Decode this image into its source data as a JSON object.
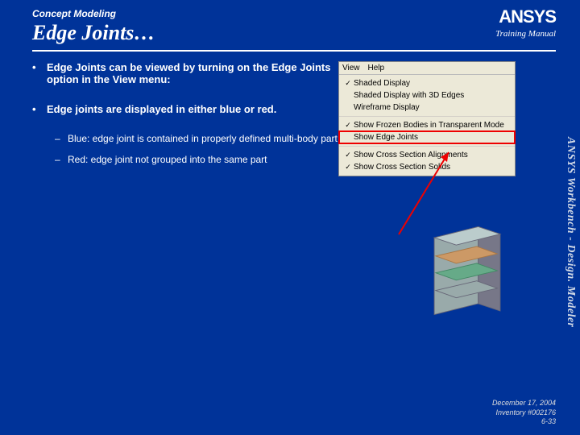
{
  "header": {
    "supertitle": "Concept Modeling",
    "title": "Edge Joints…",
    "logo": "ANSYS",
    "training": "Training Manual"
  },
  "bullets": {
    "b1": "Edge Joints can be viewed by turning on the Edge Joints option in the View menu:",
    "b2": "Edge joints are displayed in either blue or red.",
    "s1": "Blue: edge joint is contained in properly defined multi-body part",
    "s2": "Red: edge joint not grouped into the same part"
  },
  "menu": {
    "bar": {
      "view": "View",
      "help": "Help"
    },
    "i1": "Shaded Display",
    "i2": "Shaded Display with 3D Edges",
    "i3": "Wireframe Display",
    "i4": "Show Frozen Bodies in Transparent Mode",
    "i5": "Show Edge Joints",
    "i6": "Show Cross Section Alignments",
    "i7": "Show Cross Section Solids"
  },
  "sidebar": "ANSYS Workbench - Design. Modeler",
  "footer": {
    "date": "December 17, 2004",
    "inv": "Inventory #002176",
    "page": "6-33"
  }
}
